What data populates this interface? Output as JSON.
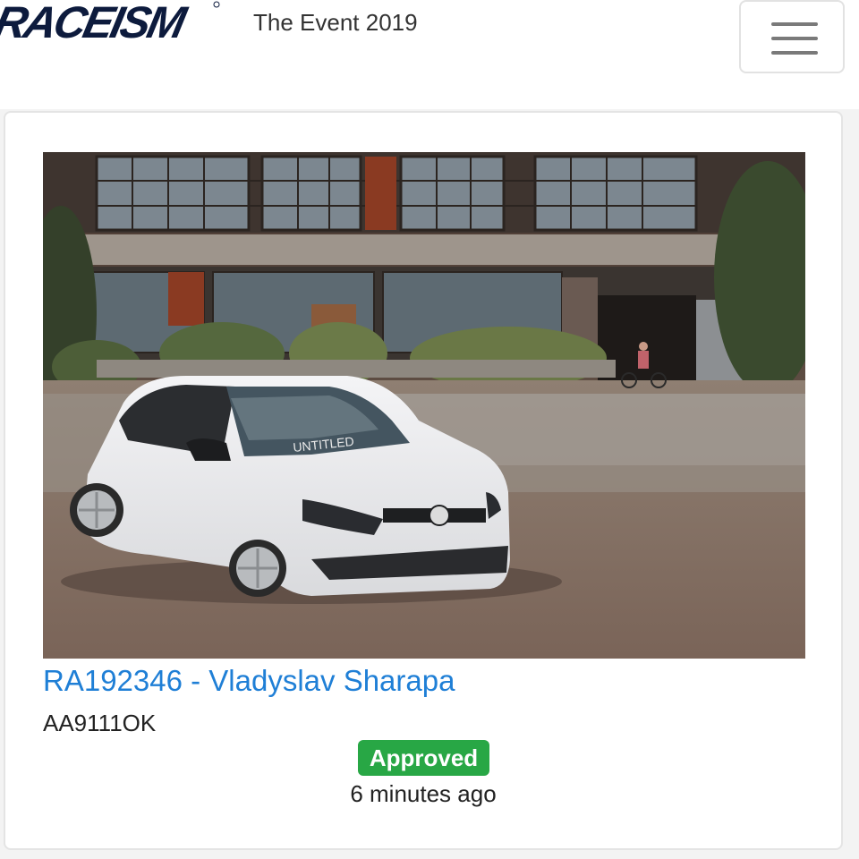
{
  "header": {
    "logo_text": "RACEISM",
    "event_title": "The Event 2019",
    "menu_icon": "hamburger-menu-icon"
  },
  "entry": {
    "link_text": "RA192346 - Vladyslav Sharapa",
    "plate": "AA9111OK",
    "status": "Approved",
    "time_ago": "6 minutes ago",
    "photo_alt": "White Volkswagen Polo parked in front of an abandoned industrial building",
    "windshield_banner": "UNTITLED"
  },
  "colors": {
    "link": "#1f7fd6",
    "status_approved": "#28a745",
    "logo": "#0d1b3d"
  }
}
